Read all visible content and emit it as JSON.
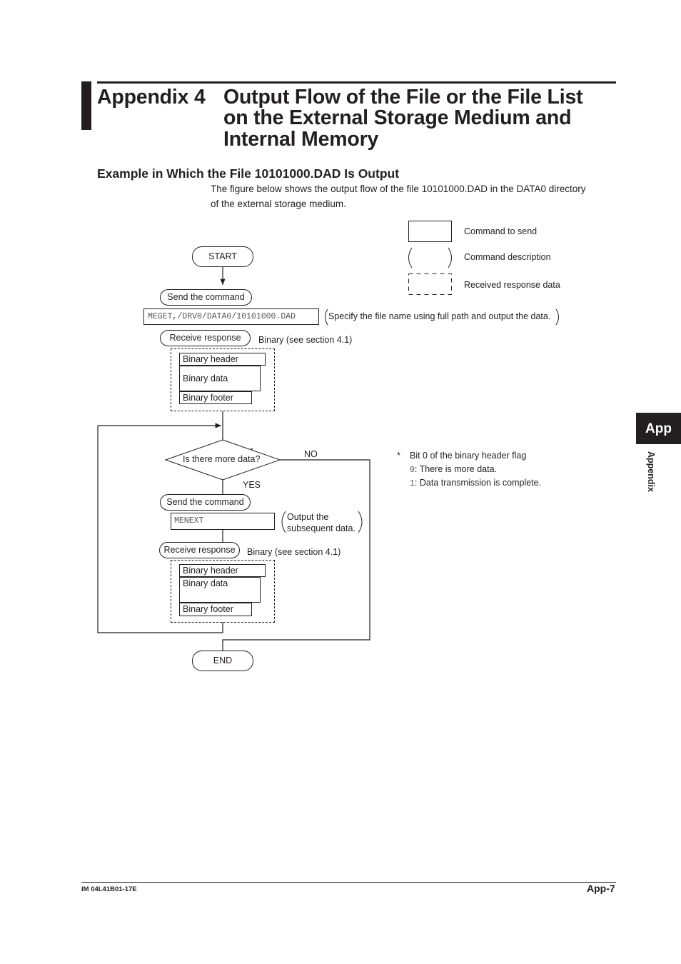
{
  "header": {
    "appendix_number": "Appendix 4",
    "title_lines": [
      "Output Flow of the File or the File List",
      "on the External Storage Medium and",
      "Internal Memory"
    ]
  },
  "section": {
    "heading": "Example in Which the File 10101000.DAD Is Output",
    "intro_lines": [
      "The figure below shows the output flow of the file 10101000.DAD in the DATA0 directory",
      "of the external storage medium."
    ]
  },
  "legend": {
    "items": [
      {
        "shape": "solid-rect",
        "label": "Command to send"
      },
      {
        "shape": "parentheses",
        "label": "Command description"
      },
      {
        "shape": "dashed-rect",
        "label": "Received response data"
      }
    ]
  },
  "flowchart": {
    "start": "START",
    "end": "END",
    "step1": {
      "send_label": "Send the command",
      "command": "MEGET,/DRV0/DATA0/10101000.DAD",
      "command_description": "Specify the file name using full path and output the data.",
      "receive_label": "Receive response",
      "response_note": "Binary (see section 4.1)",
      "blocks": [
        "Binary header",
        "Binary data",
        "Binary footer"
      ]
    },
    "decision": {
      "question": "Is there more data?",
      "marker": "*",
      "yes_label": "YES",
      "no_label": "NO"
    },
    "step2": {
      "send_label": "Send the command",
      "command": "MENEXT",
      "command_description_lines": [
        "Output the",
        "subsequent data."
      ],
      "receive_label": "Receive response",
      "response_note": "Binary (see section 4.1)",
      "blocks": [
        "Binary header",
        "Binary data",
        "Binary footer"
      ]
    }
  },
  "footnote": {
    "marker": "*",
    "title": "Bit 0 of the binary header flag",
    "entries": [
      {
        "code": "0",
        "sep": ":",
        "text": "There is more data."
      },
      {
        "code": "1",
        "sep": ":",
        "text": "Data transmission is complete."
      }
    ]
  },
  "side_tab": {
    "label": "App",
    "vertical_label": "Appendix"
  },
  "footer": {
    "document_id": "IM 04L41B01-17E",
    "page": "App-7"
  }
}
